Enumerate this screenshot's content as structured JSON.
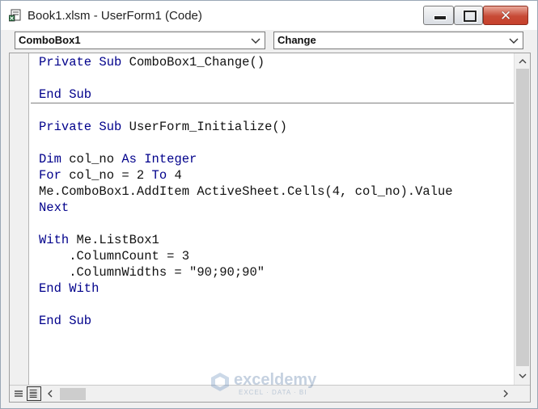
{
  "window": {
    "title": "Book1.xlsm - UserForm1 (Code)",
    "close_glyph": "✕"
  },
  "combos": {
    "object": "ComboBox1",
    "procedure": "Change"
  },
  "code": {
    "lines": [
      "Private Sub ComboBox1_Change()",
      "",
      "End Sub",
      "",
      "Private Sub UserForm_Initialize()",
      "",
      "Dim col_no As Integer",
      "For col_no = 2 To 4",
      "Me.ComboBox1.AddItem ActiveSheet.Cells(4, col_no).Value",
      "Next",
      "",
      "With Me.ListBox1",
      "    .ColumnCount = 3",
      "    .ColumnWidths = \"90;90;90\"",
      "End With",
      "",
      "End Sub"
    ]
  },
  "watermark": {
    "brand": "exceldemy",
    "tagline": "EXCEL · DATA · BI"
  },
  "colors": {
    "keyword": "#00008b",
    "text": "#111111",
    "close_button": "#c7412c"
  },
  "icons": {
    "window": "vba-module-icon",
    "dropdown": "chevron-down-icon",
    "scroll_up": "chevron-up-icon",
    "scroll_down": "chevron-down-icon",
    "scroll_left": "chevron-left-icon",
    "scroll_right": "chevron-right-icon"
  }
}
